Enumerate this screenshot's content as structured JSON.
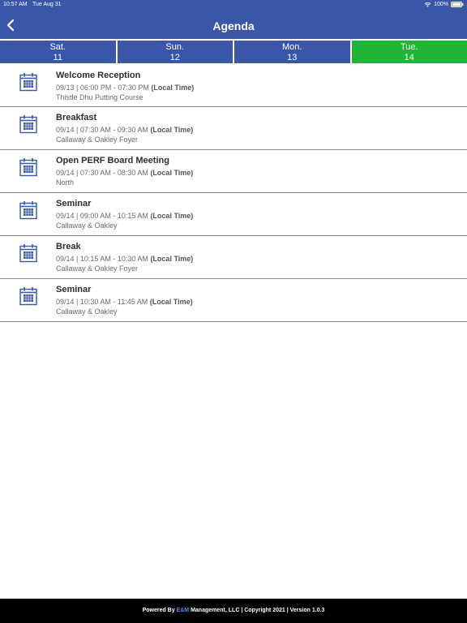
{
  "status": {
    "time": "10:57 AM",
    "date": "Tue Aug 31",
    "battery": "100%"
  },
  "header": {
    "title": "Agenda"
  },
  "days": [
    {
      "name": "Sat.",
      "num": "11",
      "active": false
    },
    {
      "name": "Sun.",
      "num": "12",
      "active": false
    },
    {
      "name": "Mon.",
      "num": "13",
      "active": false
    },
    {
      "name": "Tue.",
      "num": "14",
      "active": true
    }
  ],
  "events": [
    {
      "title": "Welcome Reception",
      "time": "09/13 | 06:00 PM - 07:30 PM",
      "tz": "(Local Time)",
      "location": "Thistle Dhu Putting Course"
    },
    {
      "title": "Breakfast",
      "time": "09/14 | 07:30 AM - 09:30 AM",
      "tz": "(Local Time)",
      "location": "Callaway & Oakley Foyer"
    },
    {
      "title": "Open PERF Board Meeting",
      "time": "09/14 | 07:30 AM - 08:30 AM",
      "tz": "(Local Time)",
      "location": "North"
    },
    {
      "title": "Seminar",
      "time": "09/14 | 09:00 AM - 10:15 AM",
      "tz": "(Local Time)",
      "location": "Callaway & Oakley"
    },
    {
      "title": "Break",
      "time": "09/14 | 10:15 AM - 10:30 AM",
      "tz": "(Local Time)",
      "location": "Callaway & Oakley Foyer"
    },
    {
      "title": "Seminar",
      "time": "09/14 | 10:30 AM - 11:45 AM",
      "tz": "(Local Time)",
      "location": "Callaway & Oakley"
    }
  ],
  "footer": {
    "prefix": "Powered By ",
    "brand": "E&M",
    "suffix": " Management, LLC | Copyright 2021 | Version 1.0.3"
  },
  "colors": {
    "header": "#3a56a8",
    "active_tab": "#1fb535",
    "footer": "#000000"
  }
}
